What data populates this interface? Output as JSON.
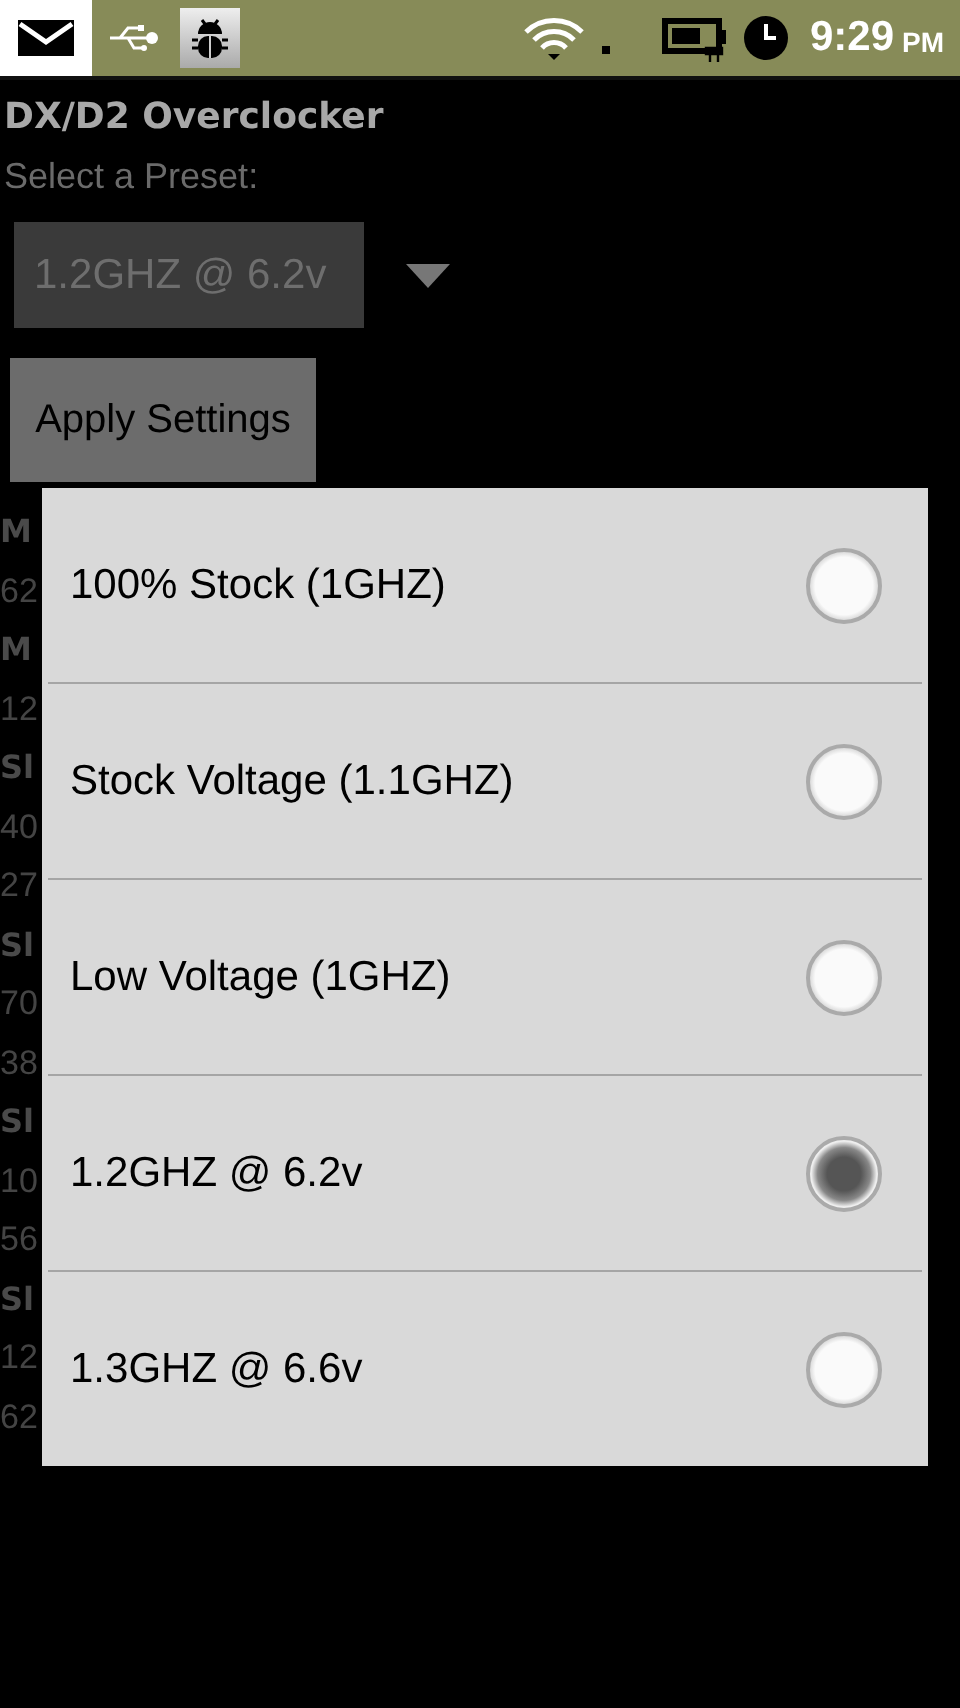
{
  "status_bar": {
    "time": "9:29",
    "am_pm": "PM"
  },
  "app": {
    "title": "DX/D2 Overclocker",
    "preset_label": "Select a Preset:",
    "preset_value": "1.2GHZ @ 6.2v",
    "apply_button": "Apply Settings",
    "fields": [
      {
        "kind": "label",
        "text": "M"
      },
      {
        "kind": "value",
        "text": "62"
      },
      {
        "kind": "label",
        "text": "M"
      },
      {
        "kind": "value",
        "text": "12"
      },
      {
        "kind": "label",
        "text": "Sl"
      },
      {
        "kind": "value",
        "text": "40"
      },
      {
        "kind": "value",
        "text": "27"
      },
      {
        "kind": "label",
        "text": "Sl"
      },
      {
        "kind": "value",
        "text": "70"
      },
      {
        "kind": "value",
        "text": "38"
      },
      {
        "kind": "label",
        "text": "Sl"
      },
      {
        "kind": "value",
        "text": "10"
      },
      {
        "kind": "value",
        "text": "56"
      },
      {
        "kind": "label",
        "text": "Sl"
      },
      {
        "kind": "value",
        "text": "12"
      },
      {
        "kind": "value",
        "text": "62"
      }
    ]
  },
  "dialog": {
    "options": [
      {
        "label": "100% Stock (1GHZ)",
        "selected": false
      },
      {
        "label": "Stock Voltage (1.1GHZ)",
        "selected": false
      },
      {
        "label": "Low Voltage (1GHZ)",
        "selected": false
      },
      {
        "label": "1.2GHZ @ 6.2v",
        "selected": true
      },
      {
        "label": "1.3GHZ @ 6.6v",
        "selected": false
      }
    ]
  }
}
